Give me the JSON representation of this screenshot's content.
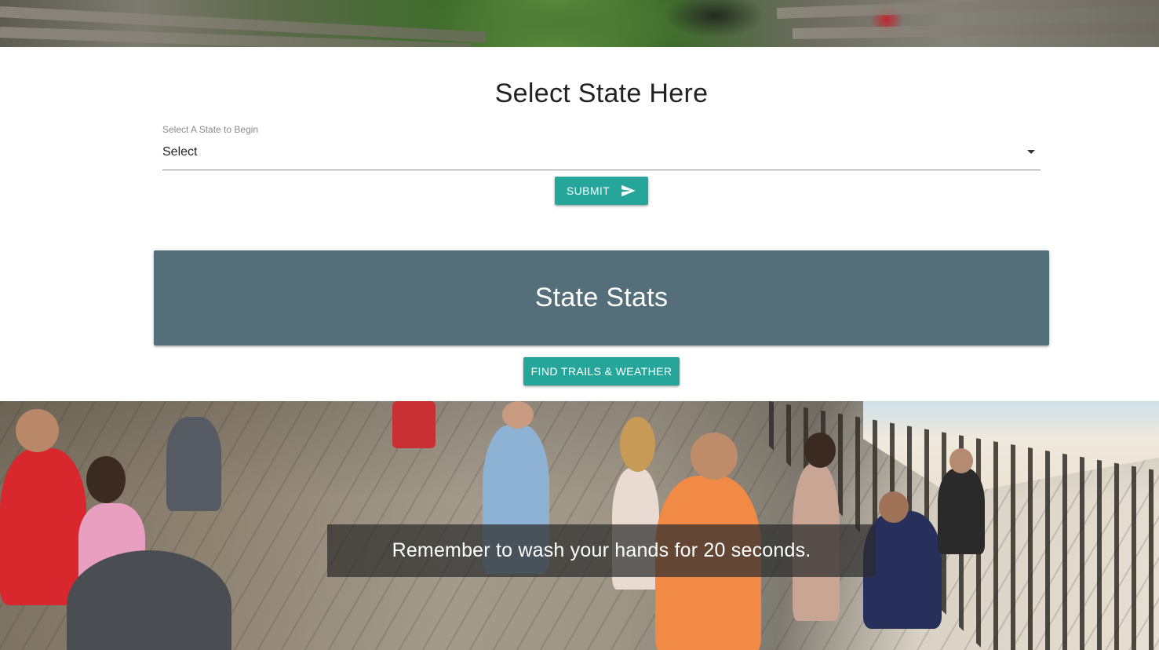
{
  "select_section": {
    "heading": "Select State Here",
    "field_label": "Select A State to Begin",
    "field_value": "Select",
    "submit_label": "SUBMIT"
  },
  "stats": {
    "title": "State Stats",
    "trails_button_label": "FIND TRAILS & WEATHER"
  },
  "banner": {
    "message": "Remember to wash your hands for 20 seconds."
  },
  "icons": {
    "submit": "send-icon",
    "select": "dropdown-caret-icon"
  },
  "colors": {
    "accent": "#26a69a",
    "stats_card": "#546e7a",
    "caption_overlay": "#2d2d2d"
  }
}
